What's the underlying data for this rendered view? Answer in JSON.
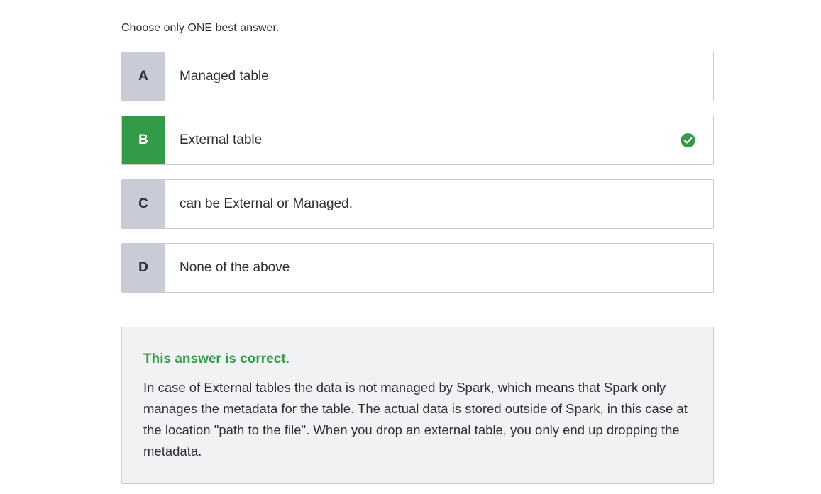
{
  "instruction": "Choose only ONE best answer.",
  "options": [
    {
      "letter": "A",
      "text": "Managed table"
    },
    {
      "letter": "B",
      "text": "External table",
      "selected_correct": true
    },
    {
      "letter": "C",
      "text": "can be External or Managed."
    },
    {
      "letter": "D",
      "text": "None of the above"
    }
  ],
  "explanation": {
    "title": "This answer is correct.",
    "body": "In case of External tables the data is not managed by Spark, which means that Spark only manages the metadata for the table. The actual data is stored outside of Spark, in this case at the location \"path to the file\". When you drop an external table, you only end up dropping the metadata."
  },
  "colors": {
    "correct_green": "#339b48",
    "letter_bg": "#c9ccd6",
    "explanation_bg": "#f1f2f4"
  },
  "icons": {
    "correct_marker": "check-circle-icon"
  }
}
